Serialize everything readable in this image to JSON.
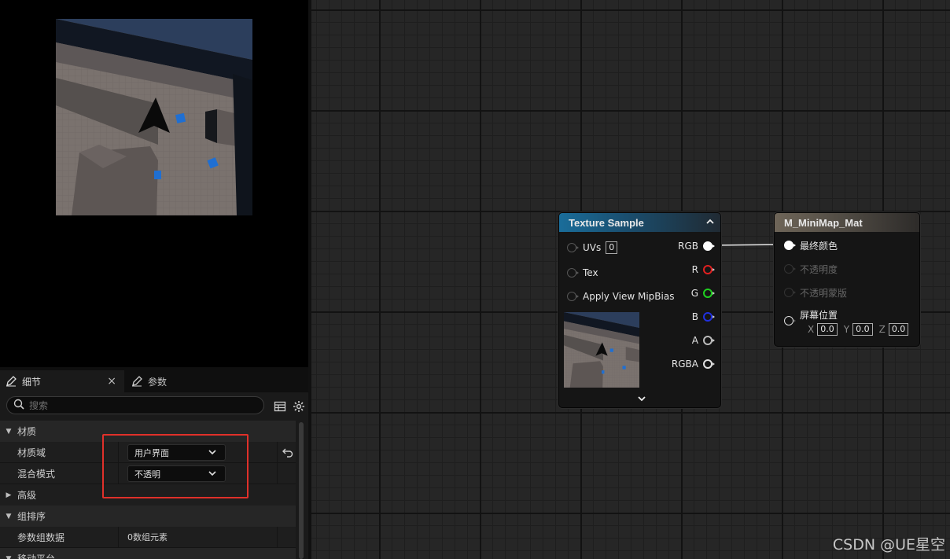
{
  "details": {
    "tabs": [
      {
        "label": "细节",
        "active": true
      },
      {
        "label": "参数",
        "active": false
      }
    ],
    "search": {
      "placeholder": "搜索"
    },
    "rows": [
      {
        "type": "category",
        "label": "材质",
        "expanded": true
      },
      {
        "type": "field",
        "label": "材质域",
        "value": "用户界面"
      },
      {
        "type": "field",
        "label": "混合模式",
        "value": "不透明"
      },
      {
        "type": "category",
        "label": "高级",
        "expanded": false
      },
      {
        "type": "category",
        "label": "组排序",
        "expanded": true
      },
      {
        "type": "field",
        "label": "参数组数据",
        "value": "0数组元素"
      },
      {
        "type": "category",
        "label": "移动平台",
        "expanded": true
      }
    ]
  },
  "texture_node": {
    "title": "Texture Sample",
    "inputs": [
      "UVs",
      "Tex",
      "Apply View MipBias"
    ],
    "uvs_value": "0",
    "outputs": [
      {
        "label": "RGB",
        "color": "#ffffff",
        "connected": true
      },
      {
        "label": "R",
        "color": "#e02020",
        "connected": false
      },
      {
        "label": "G",
        "color": "#20d020",
        "connected": false
      },
      {
        "label": "B",
        "color": "#2030e0",
        "connected": false
      },
      {
        "label": "A",
        "color": "#bbbbbb",
        "connected": false
      },
      {
        "label": "RGBA",
        "color": "#e0e0e0",
        "connected": false
      }
    ]
  },
  "material_node": {
    "title": "M_MiniMap_Mat",
    "inputs": [
      {
        "label": "最终颜色",
        "enabled": true,
        "connected": true
      },
      {
        "label": "不透明度",
        "enabled": false,
        "connected": false
      },
      {
        "label": "不透明蒙版",
        "enabled": false,
        "connected": false
      },
      {
        "label": "屏幕位置",
        "enabled": true,
        "connected": false
      }
    ],
    "screen_position": {
      "x_label": "X",
      "x": "0.0",
      "y_label": "Y",
      "y": "0.0",
      "z_label": "Z",
      "z": "0.0"
    }
  },
  "watermark": "CSDN @UE星空",
  "colors": {
    "highlight": "#e0302a",
    "texture_header": "#1a6d9a",
    "material_header": "#6e6558"
  }
}
